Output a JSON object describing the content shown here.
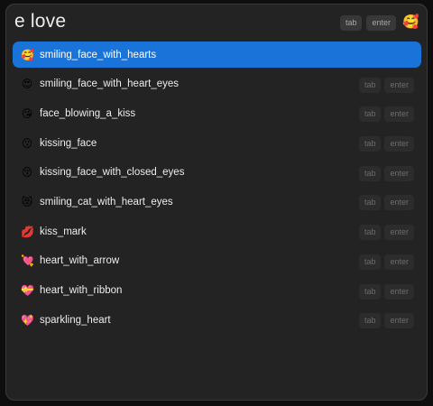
{
  "search": {
    "query": "e love"
  },
  "header": {
    "hint_tab": "tab",
    "hint_enter": "enter",
    "preview_emoji": "🥰"
  },
  "row_hints": {
    "tab": "tab",
    "enter": "enter"
  },
  "results": [
    {
      "emoji": "🥰",
      "label": "smiling_face_with_hearts",
      "selected": true
    },
    {
      "emoji": "😍",
      "label": "smiling_face_with_heart_eyes",
      "selected": false
    },
    {
      "emoji": "😘",
      "label": "face_blowing_a_kiss",
      "selected": false
    },
    {
      "emoji": "😗",
      "label": "kissing_face",
      "selected": false
    },
    {
      "emoji": "😚",
      "label": "kissing_face_with_closed_eyes",
      "selected": false
    },
    {
      "emoji": "😻",
      "label": "smiling_cat_with_heart_eyes",
      "selected": false
    },
    {
      "emoji": "💋",
      "label": "kiss_mark",
      "selected": false
    },
    {
      "emoji": "💘",
      "label": "heart_with_arrow",
      "selected": false
    },
    {
      "emoji": "💝",
      "label": "heart_with_ribbon",
      "selected": false
    },
    {
      "emoji": "💖",
      "label": "sparkling_heart",
      "selected": false
    }
  ],
  "colors": {
    "selection": "#1a73d9",
    "window_bg": "#232323",
    "text": "#ededed"
  }
}
